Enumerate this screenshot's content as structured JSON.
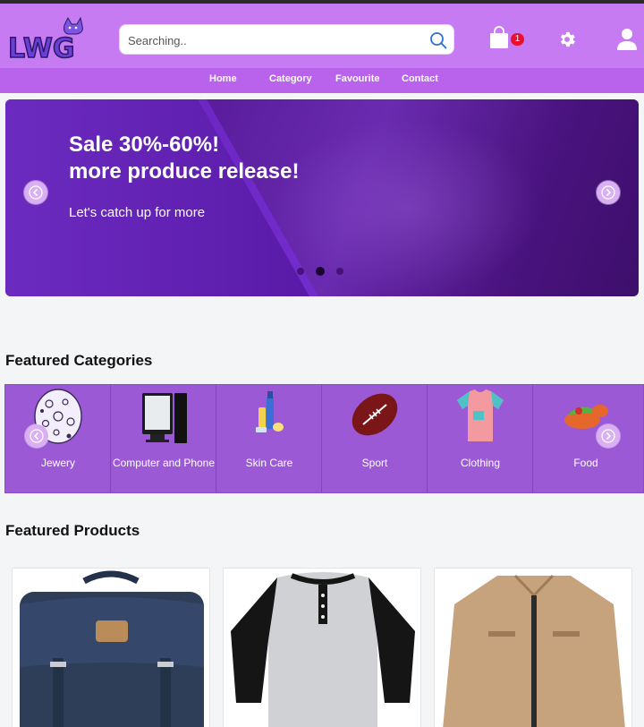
{
  "header": {
    "logo_text": "LWG",
    "search": {
      "placeholder": "Searching..",
      "value": ""
    },
    "cart_count": "1"
  },
  "nav": {
    "items": [
      "Home",
      "Category",
      "Favourite",
      "Contact"
    ]
  },
  "hero": {
    "title_line1": "Sale 30%-60%!",
    "title_line2": "more produce release!",
    "subtitle": "Let's catch up for more",
    "slides": 3,
    "active_slide": 2
  },
  "featured_categories": {
    "title": "Featured Categories",
    "items": [
      {
        "label": "Jewery",
        "icon": "jewelry-icon"
      },
      {
        "label": "Computer and Phone",
        "icon": "computer-icon"
      },
      {
        "label": "Skin Care",
        "icon": "skin-care-icon"
      },
      {
        "label": "Sport",
        "icon": "football-icon"
      },
      {
        "label": "Clothing",
        "icon": "shirt-icon"
      },
      {
        "label": "Food",
        "icon": "food-icon"
      }
    ]
  },
  "featured_products": {
    "title": "Featured Products",
    "items": [
      {
        "image": "navy-backpack"
      },
      {
        "image": "raglan-henley-shirt"
      },
      {
        "image": "khaki-jacket"
      }
    ]
  },
  "colors": {
    "header_bg": "#c77bf2",
    "nav_bg": "#b963ec",
    "hero_bg": "#5a1b9b",
    "categories_bg": "#9b59d6",
    "badge": "#e8102e"
  }
}
